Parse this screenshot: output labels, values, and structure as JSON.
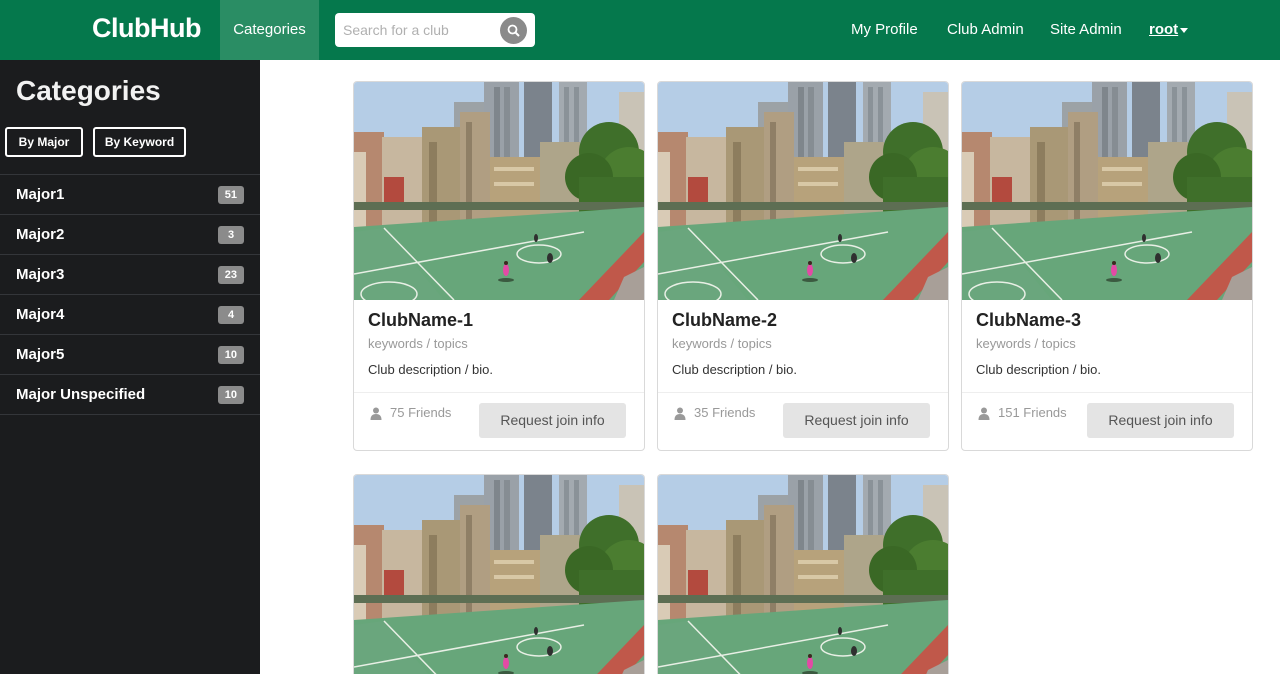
{
  "navbar": {
    "brand": "ClubHub",
    "categories_label": "Categories",
    "search_placeholder": "Search for a club",
    "links": [
      "My Profile",
      "Club Admin",
      "Site Admin"
    ],
    "user": "root",
    "bg_color": "#05784c"
  },
  "sidebar": {
    "title": "Categories",
    "filters": [
      "By Major",
      "By Keyword"
    ],
    "majors": [
      {
        "label": "Major1",
        "count": "51"
      },
      {
        "label": "Major2",
        "count": "3"
      },
      {
        "label": "Major3",
        "count": "23"
      },
      {
        "label": "Major4",
        "count": "4"
      },
      {
        "label": "Major5",
        "count": "10"
      },
      {
        "label": "Major Unspecified",
        "count": "10"
      }
    ]
  },
  "clubs": [
    {
      "name": "ClubName-1",
      "keywords": "keywords / topics",
      "description": "Club description / bio.",
      "friends": "75 Friends",
      "button": "Request join info"
    },
    {
      "name": "ClubName-2",
      "keywords": "keywords / topics",
      "description": "Club description / bio.",
      "friends": "35 Friends",
      "button": "Request join info"
    },
    {
      "name": "ClubName-3",
      "keywords": "keywords / topics",
      "description": "Club description / bio.",
      "friends": "151 Friends",
      "button": "Request join info"
    },
    {
      "name": "",
      "keywords": "",
      "description": "",
      "friends": "",
      "button": ""
    },
    {
      "name": "",
      "keywords": "",
      "description": "",
      "friends": "",
      "button": ""
    }
  ]
}
